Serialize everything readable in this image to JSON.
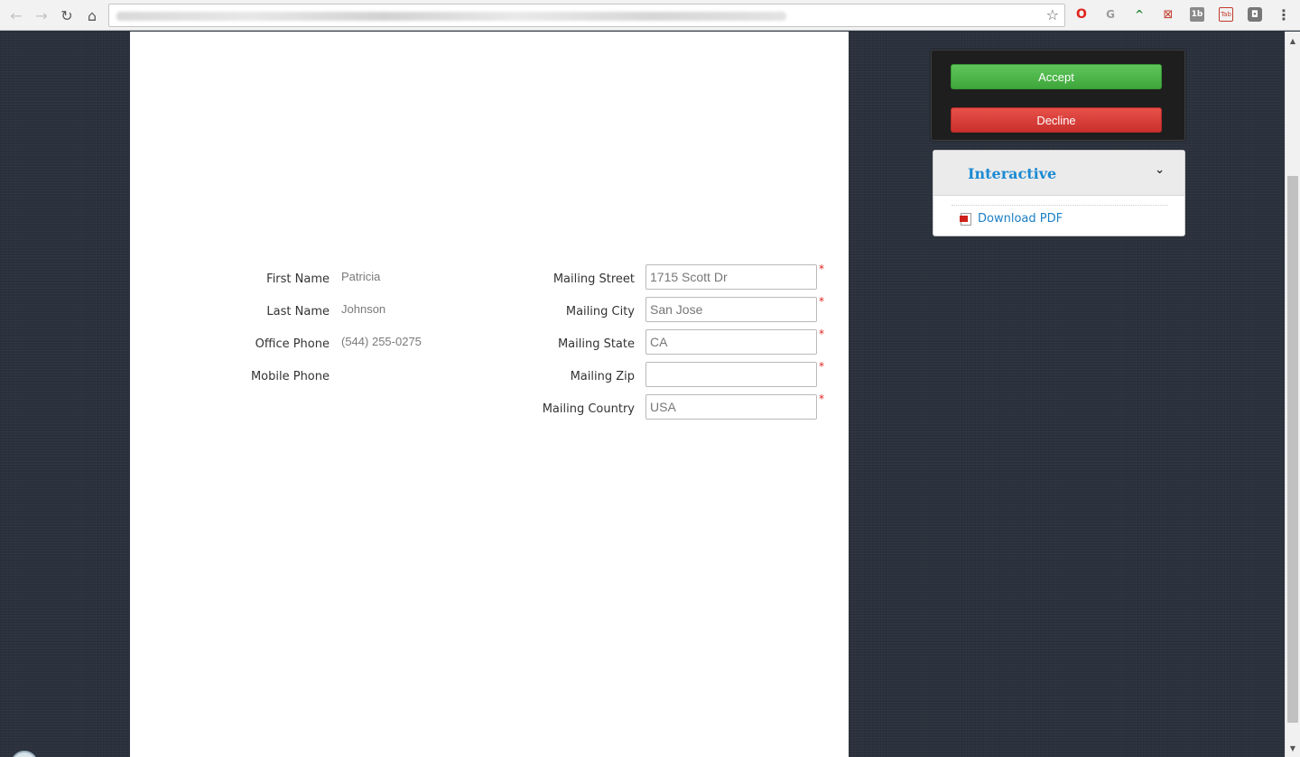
{
  "browser": {
    "back_icon": "←",
    "forward_icon": "→",
    "reload_icon": "↻",
    "home_icon": "⌂",
    "star_icon": "☆",
    "menu_icon": "⋮",
    "extensions": [
      "O",
      "G",
      "^",
      "⊠",
      "1b",
      "Tab",
      "◘"
    ]
  },
  "form": {
    "left": [
      {
        "label": "First Name",
        "value": "Patricia"
      },
      {
        "label": "Last Name",
        "value": "Johnson"
      },
      {
        "label": "Office Phone",
        "value": "(544) 255-0275"
      },
      {
        "label": "Mobile Phone",
        "value": ""
      }
    ],
    "right": [
      {
        "label": "Mailing Street",
        "value": "1715 Scott Dr",
        "required": "*"
      },
      {
        "label": "Mailing City",
        "value": "San Jose",
        "required": "*"
      },
      {
        "label": "Mailing State",
        "value": "CA",
        "required": "*"
      },
      {
        "label": "Mailing Zip",
        "value": "",
        "required": "*"
      },
      {
        "label": "Mailing Country",
        "value": "USA",
        "required": "*"
      }
    ]
  },
  "actions": {
    "accept_label": "Accept",
    "decline_label": "Decline"
  },
  "info": {
    "title": "Interactive",
    "chevron": "⌄",
    "download_label": "Download PDF"
  },
  "colors": {
    "accept": "#4cb648",
    "decline": "#d9413c",
    "link": "#1b7fc4",
    "required": "#e0241d"
  }
}
